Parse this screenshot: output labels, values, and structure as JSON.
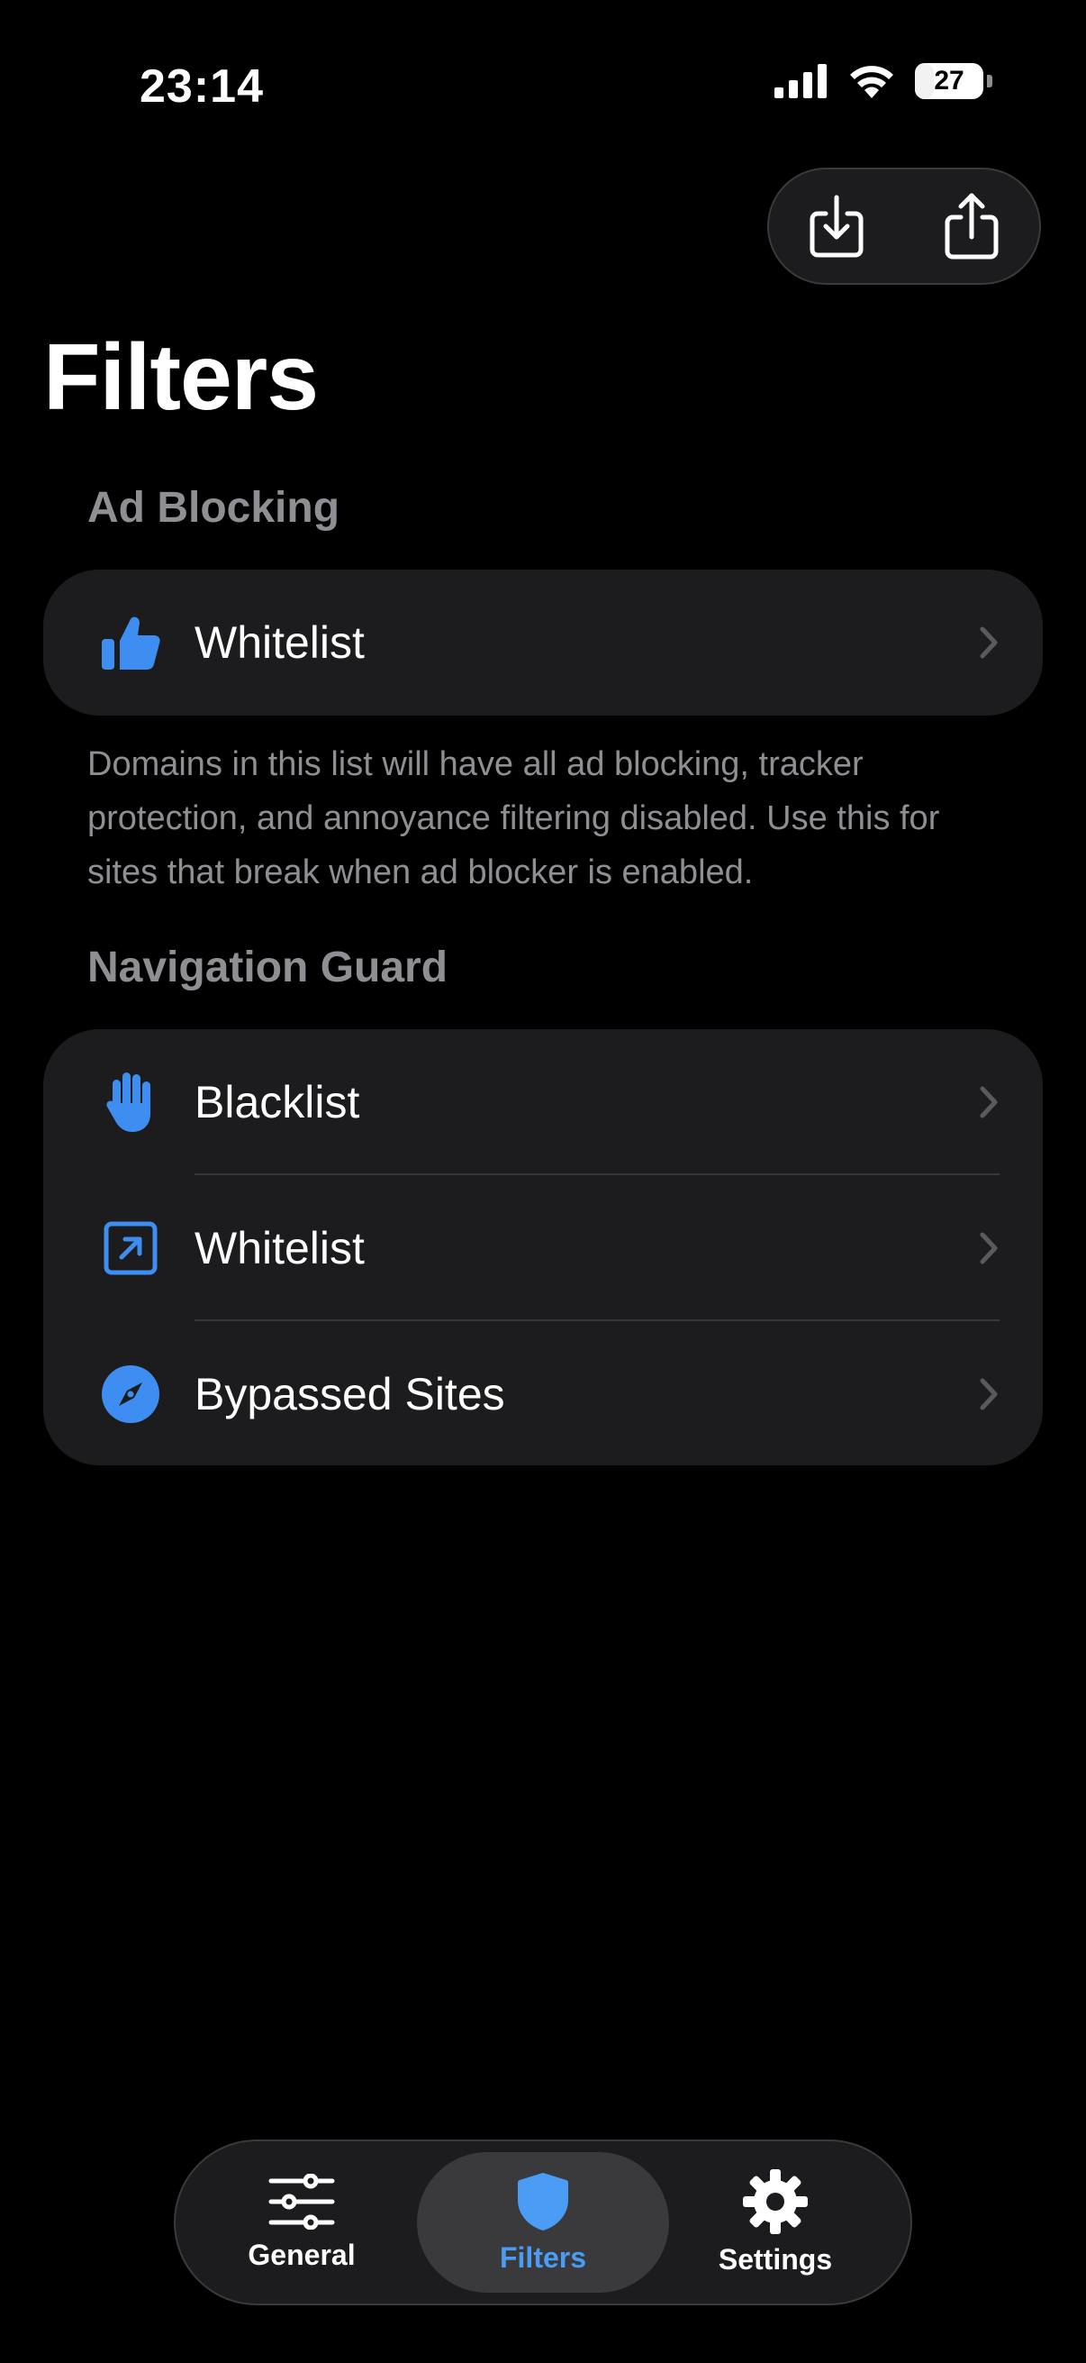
{
  "status_bar": {
    "time": "23:14",
    "battery": "27",
    "battery_level": 0.27
  },
  "header": {
    "title": "Filters",
    "import_icon": "import-icon",
    "share_icon": "share-icon"
  },
  "ad_blocking": {
    "header": "Ad Blocking",
    "items": [
      {
        "label": "Whitelist",
        "icon": "thumbs-up-icon"
      }
    ],
    "footer": "Domains in this list will have all ad blocking, tracker protection, and annoyance filtering disabled. Use this for sites that break when ad blocker is enabled."
  },
  "navigation_guard": {
    "header": "Navigation Guard",
    "items": [
      {
        "label": "Blacklist",
        "icon": "hand-raised-icon"
      },
      {
        "label": "Whitelist",
        "icon": "arrow-up-right-square-icon"
      },
      {
        "label": "Bypassed Sites",
        "icon": "compass-icon"
      }
    ]
  },
  "tabbar": {
    "tabs": [
      {
        "label": "General",
        "icon": "sliders-icon"
      },
      {
        "label": "Filters",
        "icon": "shield-icon",
        "active": true
      },
      {
        "label": "Settings",
        "icon": "gear-icon"
      }
    ]
  },
  "colors": {
    "accent": "#3d8ef0",
    "background": "#000000",
    "card": "#1c1c1e",
    "secondary_text": "#8e8e93"
  }
}
